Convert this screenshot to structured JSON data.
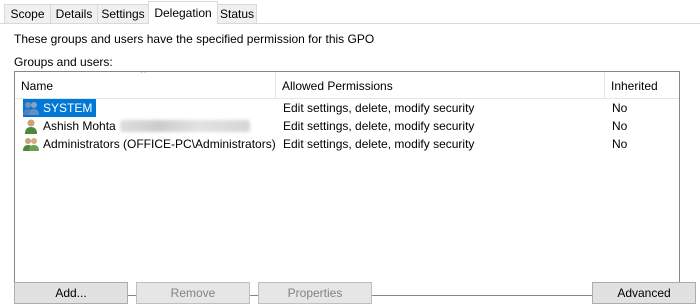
{
  "tabs": [
    {
      "label": "Scope"
    },
    {
      "label": "Details"
    },
    {
      "label": "Settings"
    },
    {
      "label": "Delegation",
      "active": true
    },
    {
      "label": "Status"
    }
  ],
  "description": "These groups and users have the specified permission for this GPO",
  "groups_label": "Groups and users:",
  "columns": {
    "name": "Name",
    "permissions": "Allowed Permissions",
    "inherited": "Inherited"
  },
  "sort_indicator": "^",
  "rows": [
    {
      "name": "SYSTEM",
      "icon": "group-icon",
      "permissions": "Edit settings, delete, modify security",
      "inherited": "No",
      "selected": true
    },
    {
      "name": "Ashish Mohta",
      "icon": "user-icon",
      "permissions": "Edit settings, delete, modify security",
      "inherited": "No",
      "selected": false
    },
    {
      "name": "Administrators (OFFICE-PC\\Administrators)",
      "icon": "group-icon",
      "permissions": "Edit settings, delete, modify security",
      "inherited": "No",
      "selected": false
    }
  ],
  "buttons": {
    "add": "Add...",
    "remove": "Remove",
    "properties": "Properties",
    "advanced": "Advanced"
  },
  "colors": {
    "selection": "#0078d7",
    "disabled_text": "#838383"
  }
}
